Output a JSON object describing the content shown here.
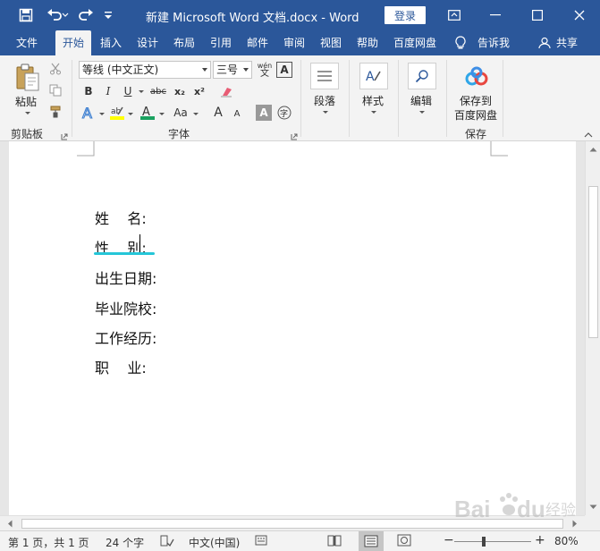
{
  "window": {
    "title": "新建 Microsoft Word 文档.docx  -  Word",
    "login": "登录"
  },
  "tabs": [
    "文件",
    "开始",
    "插入",
    "设计",
    "布局",
    "引用",
    "邮件",
    "审阅",
    "视图",
    "帮助",
    "百度网盘"
  ],
  "tell_me": "告诉我",
  "share": "共享",
  "ribbon": {
    "clipboard": {
      "paste": "粘贴",
      "label": "剪贴板"
    },
    "font": {
      "font_name": "等线 (中文正文)",
      "font_size": "三号",
      "label": "字体",
      "bold": "B",
      "italic": "I",
      "underline": "U",
      "strike": "abc",
      "subscript": "x₂",
      "superscript": "x²",
      "grow": "A",
      "shrink": "A",
      "change_case": "Aa",
      "wen": "wén",
      "wen_char": "文"
    },
    "paragraph": {
      "label": "段落"
    },
    "styles": {
      "label": "样式"
    },
    "editing": {
      "label": "编辑"
    },
    "save": {
      "button": "保存到\n百度网盘",
      "line1": "保存到",
      "line2": "百度网盘",
      "label": "保存"
    }
  },
  "document": {
    "lines": [
      "姓    名:",
      "性    别:",
      "出生日期:",
      "毕业院校:",
      "工作经历:",
      "职    业:"
    ]
  },
  "status": {
    "page": "第 1 页，共 1 页",
    "words": "24 个字",
    "language": "中文(中国)",
    "zoom": "80%",
    "zoom_value": 80
  },
  "watermark": "Baidu 经验"
}
